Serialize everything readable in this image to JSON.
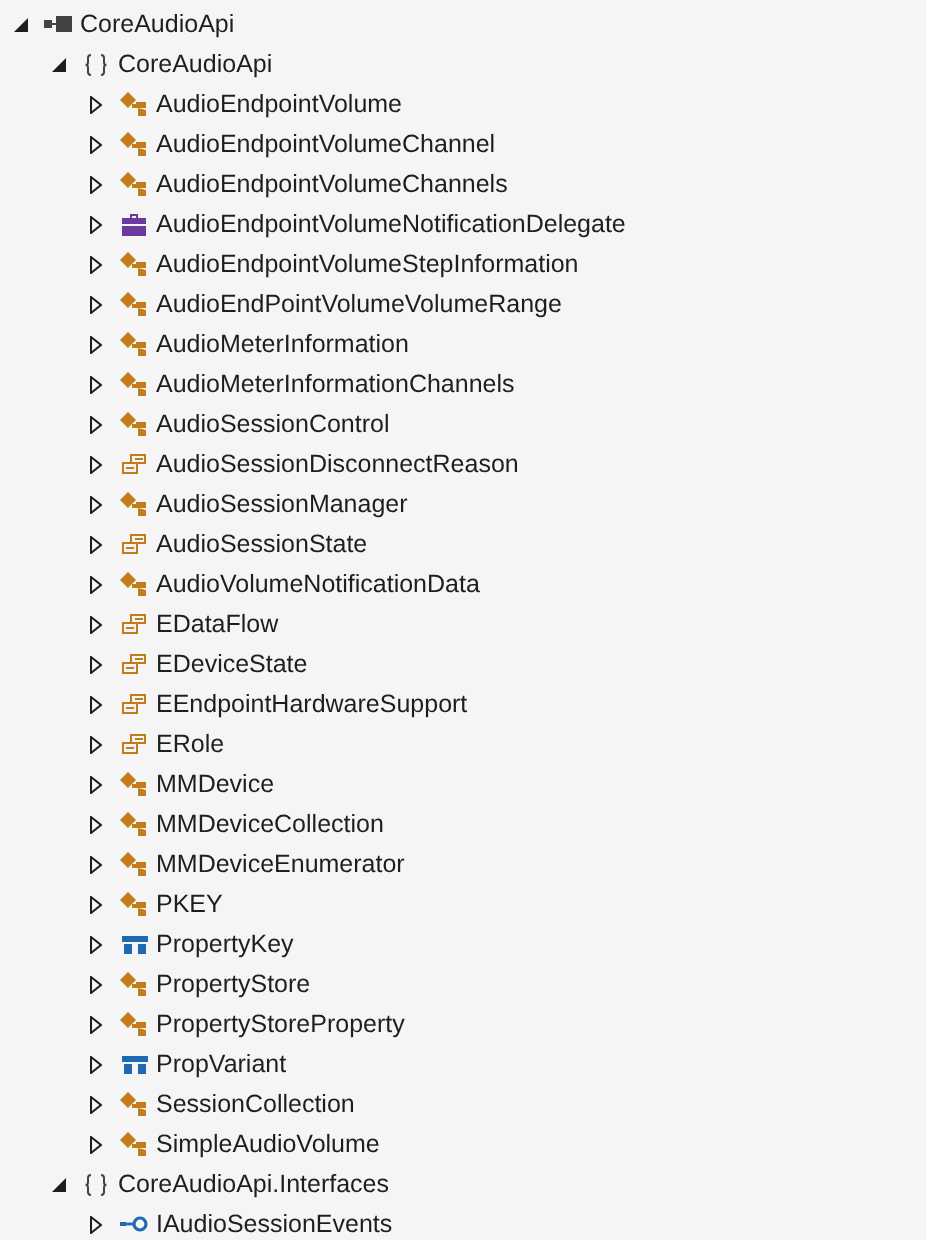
{
  "tree": [
    {
      "kind": "assembly",
      "label": "CoreAudioApi",
      "expanded": true,
      "children": [
        {
          "kind": "namespace",
          "label": "CoreAudioApi",
          "expanded": true,
          "children": [
            {
              "kind": "class",
              "label": "AudioEndpointVolume",
              "expanded": false
            },
            {
              "kind": "class",
              "label": "AudioEndpointVolumeChannel",
              "expanded": false
            },
            {
              "kind": "class",
              "label": "AudioEndpointVolumeChannels",
              "expanded": false
            },
            {
              "kind": "delegate",
              "label": "AudioEndpointVolumeNotificationDelegate",
              "expanded": false
            },
            {
              "kind": "class",
              "label": "AudioEndpointVolumeStepInformation",
              "expanded": false
            },
            {
              "kind": "class",
              "label": "AudioEndPointVolumeVolumeRange",
              "expanded": false
            },
            {
              "kind": "class",
              "label": "AudioMeterInformation",
              "expanded": false
            },
            {
              "kind": "class",
              "label": "AudioMeterInformationChannels",
              "expanded": false
            },
            {
              "kind": "class",
              "label": "AudioSessionControl",
              "expanded": false
            },
            {
              "kind": "enum",
              "label": "AudioSessionDisconnectReason",
              "expanded": false
            },
            {
              "kind": "class",
              "label": "AudioSessionManager",
              "expanded": false
            },
            {
              "kind": "enum",
              "label": "AudioSessionState",
              "expanded": false
            },
            {
              "kind": "class",
              "label": "AudioVolumeNotificationData",
              "expanded": false
            },
            {
              "kind": "enum",
              "label": "EDataFlow",
              "expanded": false
            },
            {
              "kind": "enum",
              "label": "EDeviceState",
              "expanded": false
            },
            {
              "kind": "enum",
              "label": "EEndpointHardwareSupport",
              "expanded": false
            },
            {
              "kind": "enum",
              "label": "ERole",
              "expanded": false
            },
            {
              "kind": "class",
              "label": "MMDevice",
              "expanded": false
            },
            {
              "kind": "class",
              "label": "MMDeviceCollection",
              "expanded": false
            },
            {
              "kind": "class",
              "label": "MMDeviceEnumerator",
              "expanded": false
            },
            {
              "kind": "class",
              "label": "PKEY",
              "expanded": false
            },
            {
              "kind": "struct",
              "label": "PropertyKey",
              "expanded": false
            },
            {
              "kind": "class",
              "label": "PropertyStore",
              "expanded": false
            },
            {
              "kind": "class",
              "label": "PropertyStoreProperty",
              "expanded": false
            },
            {
              "kind": "struct",
              "label": "PropVariant",
              "expanded": false
            },
            {
              "kind": "class",
              "label": "SessionCollection",
              "expanded": false
            },
            {
              "kind": "class",
              "label": "SimpleAudioVolume",
              "expanded": false
            }
          ]
        },
        {
          "kind": "namespace",
          "label": "CoreAudioApi.Interfaces",
          "expanded": true,
          "children": [
            {
              "kind": "interface",
              "label": "IAudioSessionEvents",
              "expanded": false
            }
          ]
        }
      ]
    }
  ]
}
